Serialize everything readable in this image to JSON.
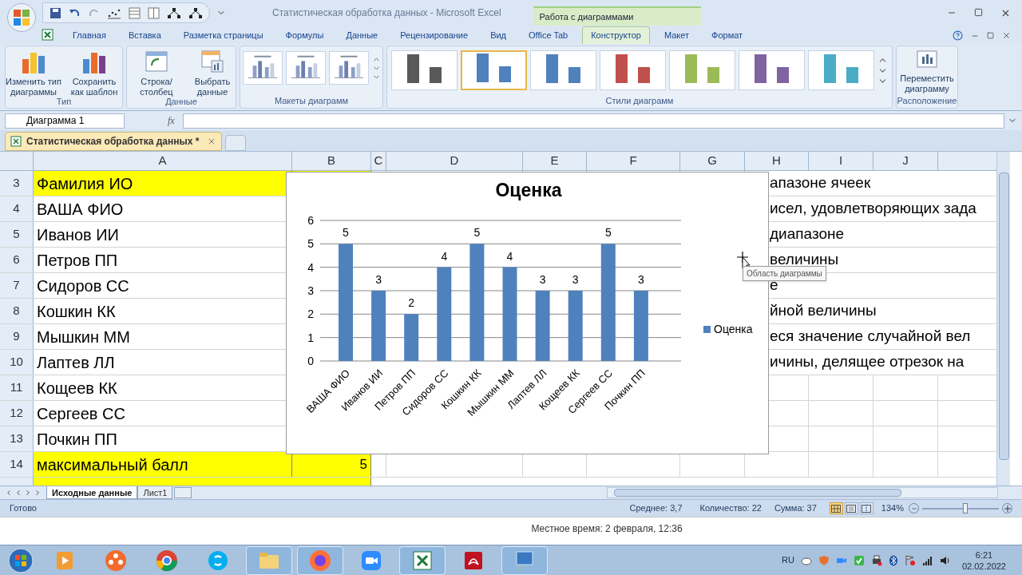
{
  "window": {
    "title": "Статистическая обработка данных - Microsoft Excel",
    "context_group": "Работа с диаграммами"
  },
  "ribbon_tabs": [
    {
      "label": "Главная",
      "selected": false
    },
    {
      "label": "Вставка",
      "selected": false
    },
    {
      "label": "Разметка страницы",
      "selected": false
    },
    {
      "label": "Формулы",
      "selected": false
    },
    {
      "label": "Данные",
      "selected": false
    },
    {
      "label": "Рецензирование",
      "selected": false
    },
    {
      "label": "Вид",
      "selected": false
    },
    {
      "label": "Office Tab",
      "selected": false
    },
    {
      "label": "Конструктор",
      "selected": true
    },
    {
      "label": "Макет",
      "selected": false
    },
    {
      "label": "Формат",
      "selected": false
    }
  ],
  "ribbon": {
    "type_group": {
      "label": "Тип",
      "buttons": [
        "Изменить тип диаграммы",
        "Сохранить как шаблон"
      ]
    },
    "data_group": {
      "label": "Данные",
      "buttons": [
        "Строка/столбец",
        "Выбрать данные"
      ]
    },
    "layouts_group": {
      "label": "Макеты диаграмм"
    },
    "styles_group": {
      "label": "Стили диаграмм",
      "styles": [
        {
          "color": "#595959",
          "selected": false
        },
        {
          "color": "#4f81bd",
          "selected": true
        },
        {
          "color": "#4f81bd",
          "selected": false
        },
        {
          "color": "#c0504d",
          "selected": false
        },
        {
          "color": "#9bbb59",
          "selected": false
        },
        {
          "color": "#8064a2",
          "selected": false
        },
        {
          "color": "#4bacc6",
          "selected": false
        }
      ]
    },
    "location_group": {
      "label": "Расположение",
      "buttons": [
        "Переместить диаграмму"
      ]
    }
  },
  "name_box": "Диаграмма 1",
  "fx": "fx",
  "document_tab": "Статистическая обработка данных *",
  "columns": [
    "A",
    "B",
    "C",
    "D",
    "E",
    "F",
    "G",
    "H",
    "I",
    "J"
  ],
  "rows": [
    {
      "number": "3",
      "a": "Фамилия ИО",
      "highlighted": true,
      "overflow": "апазоне ячеек"
    },
    {
      "number": "4",
      "a": "ВАША ФИО",
      "highlighted": false,
      "overflow": "исел, удовлетворяющих зада"
    },
    {
      "number": "5",
      "a": "Иванов ИИ",
      "highlighted": false,
      "overflow": "диапазоне"
    },
    {
      "number": "6",
      "a": "Петров ПП",
      "highlighted": false,
      "overflow": "величины"
    },
    {
      "number": "7",
      "a": "Сидоров СС",
      "highlighted": false,
      "overflow": "е"
    },
    {
      "number": "8",
      "a": "Кошкин КК",
      "highlighted": false,
      "overflow": "йной величины"
    },
    {
      "number": "9",
      "a": "Мышкин ММ",
      "highlighted": false,
      "overflow": "еся значение случайной вел"
    },
    {
      "number": "10",
      "a": "Лаптев ЛЛ",
      "highlighted": false,
      "overflow": "ичины, делящее отрезок на"
    },
    {
      "number": "11",
      "a": "Кощеев КК",
      "highlighted": false
    },
    {
      "number": "12",
      "a": "Сергеев СС",
      "highlighted": false
    },
    {
      "number": "13",
      "a": "Почкин ПП",
      "highlighted": false
    },
    {
      "number": "14",
      "a": "максимальный балл",
      "b": "5",
      "highlighted": true
    }
  ],
  "partial_row": {
    "highlighted": true
  },
  "chart": {
    "chart_data": {
      "type": "bar",
      "title": "Оценка",
      "categories": [
        "ВАША ФИО",
        "Иванов ИИ",
        "Петров ПП",
        "Сидоров СС",
        "Кошкин КК",
        "Мышкин ММ",
        "Лаптев ЛЛ",
        "Кощеев КК",
        "Сергеев СС",
        "Почкин ПП"
      ],
      "series": [
        {
          "name": "Оценка",
          "color": "#4f81bd",
          "values": [
            5,
            3,
            2,
            4,
            5,
            4,
            3,
            3,
            5,
            3
          ]
        }
      ],
      "ylim": [
        0,
        6
      ],
      "yticks": [
        0,
        1,
        2,
        3,
        4,
        5,
        6
      ],
      "data_labels": true,
      "grid": true
    }
  },
  "tooltip": "Область диаграммы",
  "sheet_tabs": [
    {
      "label": "Исходные данные",
      "selected": true
    },
    {
      "label": "Лист1",
      "selected": false
    }
  ],
  "status_bar": {
    "ready": "Готово",
    "average": "Среднее: 3,7",
    "count": "Количество: 22",
    "sum": "Сумма: 37",
    "zoom": "134%",
    "zoom_slider": {
      "level": 0.56
    },
    "views": [
      {
        "kind": "normal",
        "selected": true
      },
      {
        "kind": "layout",
        "selected": false
      },
      {
        "kind": "pagebreak",
        "selected": false
      }
    ]
  },
  "info_bar": "Местное время: 2 февраля, 12:36",
  "taskbar": {
    "language": "RU",
    "time": "6:21",
    "date": "02.02.2022"
  }
}
